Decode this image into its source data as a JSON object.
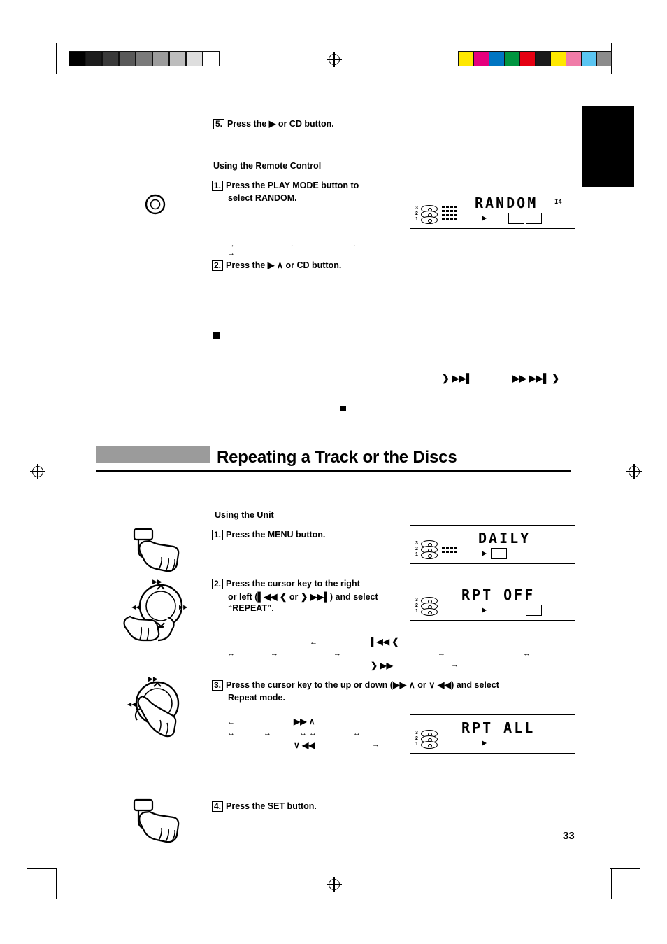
{
  "page": {
    "number": "33"
  },
  "steps_top": {
    "step5": {
      "num": "5.",
      "text": "Press the ▶ or CD button."
    }
  },
  "remote_section": {
    "heading": "Using the Remote Control",
    "step1": {
      "num": "1.",
      "line1": "Press the PLAY MODE button to",
      "line2": "select RANDOM."
    },
    "step2": {
      "num": "2.",
      "text": "Press the ▶  ∧  or CD button."
    },
    "arrow_row": [
      "→",
      "→",
      "→",
      "→"
    ]
  },
  "mid_symbols": {
    "left_block": "■",
    "small_block": "■",
    "cursor_left": "❯ ▶▶▌",
    "cursor_right": "▶▶ ▶▶▌ ❯"
  },
  "title": {
    "text": "Repeating a Track or the Discs"
  },
  "unit_section": {
    "heading": "Using the Unit",
    "step1": {
      "num": "1.",
      "text": "Press the MENU button."
    },
    "step2": {
      "num": "2.",
      "line1": "Press the cursor key to the right",
      "line2": "or left (▌◀◀ ❮ or ❯ ▶▶▌) and select",
      "line3": "“REPEAT”."
    },
    "step3": {
      "num": "3.",
      "line1": "Press the cursor key to the up or down (▶▶  ∧  or  ∨  ◀◀) and select",
      "line2": "Repeat mode."
    },
    "step4": {
      "num": "4.",
      "text": "Press the SET button."
    }
  },
  "arrows_block_a": {
    "r1": [
      "←",
      "▌◀◀ ❮"
    ],
    "r2": [
      "↔",
      "↔",
      "↔",
      "↔",
      "↔"
    ],
    "r3": [
      "❯ ▶▶",
      "→"
    ]
  },
  "arrows_block_b": {
    "r1": [
      "←",
      "▶▶  ∧"
    ],
    "r2": [
      "↔",
      "↔",
      "↔ ↔",
      "↔"
    ],
    "r3": [
      "∨  ◀◀",
      "→"
    ]
  },
  "displays": {
    "random": {
      "text": "RANDOM",
      "disc_labels": [
        "3",
        "2",
        "1"
      ],
      "badge": "I4"
    },
    "daily": {
      "text": "DAILY",
      "disc_labels": [
        "3",
        "2",
        "1"
      ]
    },
    "rpt_off": {
      "text": "RPT OFF",
      "disc_labels": [
        "3",
        "2",
        "1"
      ]
    },
    "rpt_all": {
      "text": "RPT ALL",
      "disc_labels": [
        "3",
        "2",
        "1"
      ]
    }
  },
  "colorbars": {
    "grayscale": [
      "#000000",
      "#1c1c1c",
      "#3a3a3a",
      "#595959",
      "#7a7a7a",
      "#9c9c9c",
      "#bdbdbd",
      "#dedede",
      "#ffffff"
    ],
    "colors": [
      "#ffe800",
      "#e5007d",
      "#0075c2",
      "#009540",
      "#e50012",
      "#1a1a1a",
      "#ffe800",
      "#f07ca8",
      "#5bc5f2",
      "#8c8c8c"
    ]
  },
  "accents": {
    "title_bar": "#9b9b9b",
    "tab_block": "#000000"
  }
}
